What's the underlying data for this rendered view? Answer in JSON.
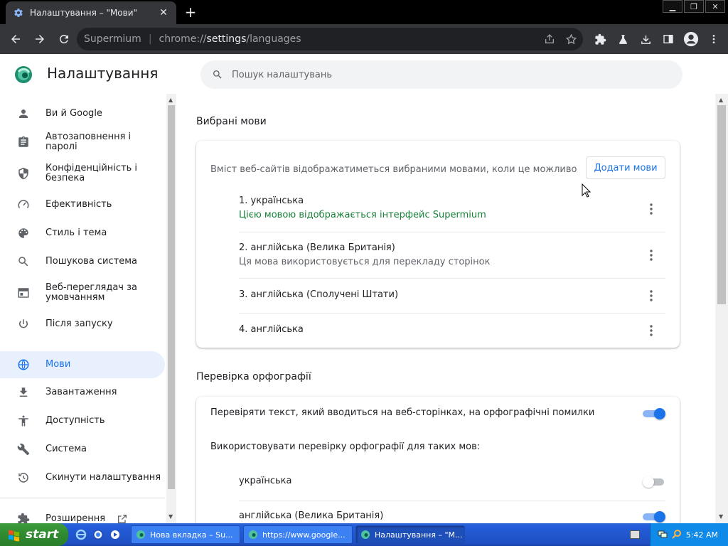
{
  "window": {
    "tab_title": "Налаштування – \"Мови\"",
    "tab_close": "✕",
    "new_tab": "+",
    "controls": {
      "minimize": "▁",
      "restore": "❐",
      "close": "✕"
    }
  },
  "toolbar": {
    "brand": "Supermium",
    "separator": "|",
    "url_scheme": "chrome://",
    "url_host": "settings",
    "url_path": "/languages"
  },
  "header": {
    "title": "Налаштування",
    "search_placeholder": "Пошук налаштувань"
  },
  "sidebar": {
    "items": [
      {
        "label": "Ви й Google",
        "icon": "person-icon"
      },
      {
        "label": "Автозаповнення і паролі",
        "icon": "clipboard-icon"
      },
      {
        "label": "Конфіденційність і безпека",
        "icon": "shield-icon"
      },
      {
        "label": "Ефективність",
        "icon": "speedometer-icon"
      },
      {
        "label": "Стиль і тема",
        "icon": "palette-icon"
      },
      {
        "label": "Пошукова система",
        "icon": "search-icon"
      },
      {
        "label": "Веб-переглядач за умовчанням",
        "icon": "browser-icon"
      },
      {
        "label": "Після запуску",
        "icon": "power-icon"
      },
      {
        "label": "Мови",
        "icon": "globe-icon"
      },
      {
        "label": "Завантаження",
        "icon": "download-icon"
      },
      {
        "label": "Доступність",
        "icon": "accessibility-icon"
      },
      {
        "label": "Система",
        "icon": "wrench-icon"
      },
      {
        "label": "Скинути налаштування",
        "icon": "history-icon"
      },
      {
        "label": "Розширення",
        "icon": "puzzle-icon"
      }
    ]
  },
  "languages": {
    "section_title": "Вибрані мови",
    "description": "Вміст веб-сайтів відображатиметься вибраними мовами, коли це можливо",
    "add_button": "Додати мови",
    "list": [
      {
        "name": "1. українська",
        "note": "Цією мовою відображається інтерфейс Supermium"
      },
      {
        "name": "2. англійська (Велика Британія)",
        "note": "Ця мова використовується для перекладу сторінок"
      },
      {
        "name": "3. англійська (Сполучені Штати)"
      },
      {
        "name": "4. англійська"
      }
    ]
  },
  "spellcheck": {
    "section_title": "Перевірка орфографії",
    "check_label": "Перевіряти текст, який вводиться на веб-сторінках, на орфографічні помилки",
    "use_for_label": "Використовувати перевірку орфографії для таких мов:",
    "languages": [
      {
        "name": "українська",
        "enabled": false
      },
      {
        "name": "англійська (Велика Британія)",
        "enabled": true
      }
    ]
  },
  "taskbar": {
    "start": "start",
    "tasks": [
      "Нова вкладка – Su...",
      "https://www.google...",
      "Налаштування – \"M..."
    ],
    "clock": "5:42 AM"
  },
  "colors": {
    "accent": "#1a73e8",
    "green_note": "#188038",
    "active_nav_bg": "#e8f0fe"
  }
}
